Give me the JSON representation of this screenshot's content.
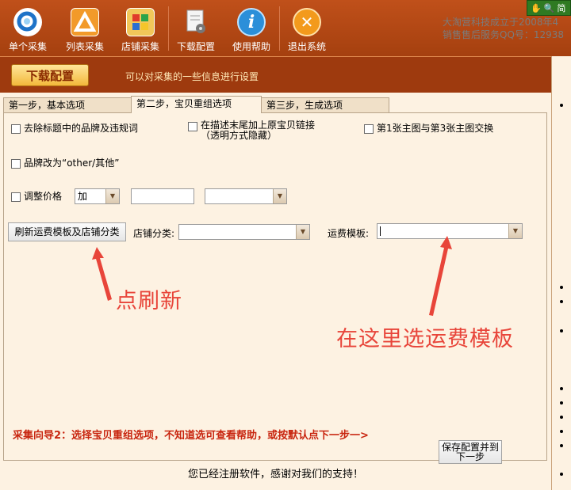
{
  "toolbar": {
    "items": [
      {
        "label": "单个采集",
        "icon": "magnifier-icon"
      },
      {
        "label": "列表采集",
        "icon": "list-triangle-icon"
      },
      {
        "label": "店铺采集",
        "icon": "store-grid-icon"
      },
      {
        "label": "下载配置",
        "icon": "document-gear-icon"
      },
      {
        "label": "使用帮助",
        "icon": "info-icon"
      },
      {
        "label": "退出系统",
        "icon": "exit-x-icon"
      }
    ],
    "info_line1": "大淘营科技成立于2008年4",
    "info_line2": "销售售后服务QQ号：12938",
    "corner_text": "简"
  },
  "header": {
    "title_button": "下载配置",
    "description": "可以对采集的一些信息进行设置"
  },
  "tabs": [
    {
      "label": "第一步，基本选项",
      "active": false
    },
    {
      "label": "第二步，宝贝重组选项",
      "active": true
    },
    {
      "label": "第三步，生成选项",
      "active": false
    }
  ],
  "options": {
    "remove_brand": "去除标题中的品牌及违规词",
    "add_link": "在描述末尾加上原宝贝链接（透明方式隐藏）",
    "swap_images": "第1张主图与第3张主图交换",
    "brand_other": "品牌改为“other/其他”",
    "adjust_price": "调整价格",
    "price_op": "加",
    "price_value": "",
    "price_unit": ""
  },
  "freight": {
    "refresh_button": "刷新运费模板及店铺分类",
    "shop_category_label": "店铺分类:",
    "shop_category_value": "",
    "template_label": "运费模板:",
    "template_value": ""
  },
  "annotations": {
    "click_refresh": "点刷新",
    "select_template": "在这里选运费模板"
  },
  "guide_text": "采集向导2：选择宝贝重组选项，不知道选可查看帮助，或按默认点下一步一>",
  "save_button": "保存配置并到下一步",
  "footer_text": "您已经注册软件，感谢对我们的支持！",
  "colors": {
    "toolbar": "#a5400f",
    "header": "#9e3a0e",
    "title_button": "#f3b83b",
    "annotation_red": "#e8453a",
    "guide_red": "#c8250f",
    "background": "#fdf2e2"
  }
}
